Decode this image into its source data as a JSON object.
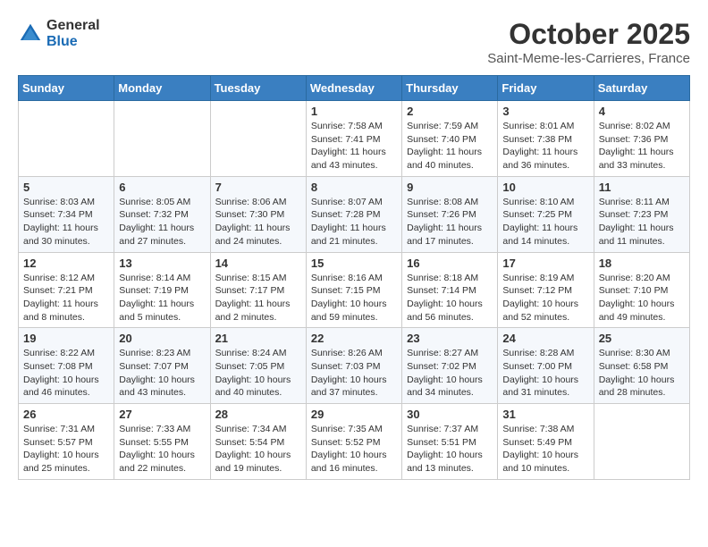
{
  "header": {
    "logo_general": "General",
    "logo_blue": "Blue",
    "month_title": "October 2025",
    "location": "Saint-Meme-les-Carrieres, France"
  },
  "weekdays": [
    "Sunday",
    "Monday",
    "Tuesday",
    "Wednesday",
    "Thursday",
    "Friday",
    "Saturday"
  ],
  "weeks": [
    [
      {
        "day": "",
        "info": ""
      },
      {
        "day": "",
        "info": ""
      },
      {
        "day": "",
        "info": ""
      },
      {
        "day": "1",
        "info": "Sunrise: 7:58 AM\nSunset: 7:41 PM\nDaylight: 11 hours and 43 minutes."
      },
      {
        "day": "2",
        "info": "Sunrise: 7:59 AM\nSunset: 7:40 PM\nDaylight: 11 hours and 40 minutes."
      },
      {
        "day": "3",
        "info": "Sunrise: 8:01 AM\nSunset: 7:38 PM\nDaylight: 11 hours and 36 minutes."
      },
      {
        "day": "4",
        "info": "Sunrise: 8:02 AM\nSunset: 7:36 PM\nDaylight: 11 hours and 33 minutes."
      }
    ],
    [
      {
        "day": "5",
        "info": "Sunrise: 8:03 AM\nSunset: 7:34 PM\nDaylight: 11 hours and 30 minutes."
      },
      {
        "day": "6",
        "info": "Sunrise: 8:05 AM\nSunset: 7:32 PM\nDaylight: 11 hours and 27 minutes."
      },
      {
        "day": "7",
        "info": "Sunrise: 8:06 AM\nSunset: 7:30 PM\nDaylight: 11 hours and 24 minutes."
      },
      {
        "day": "8",
        "info": "Sunrise: 8:07 AM\nSunset: 7:28 PM\nDaylight: 11 hours and 21 minutes."
      },
      {
        "day": "9",
        "info": "Sunrise: 8:08 AM\nSunset: 7:26 PM\nDaylight: 11 hours and 17 minutes."
      },
      {
        "day": "10",
        "info": "Sunrise: 8:10 AM\nSunset: 7:25 PM\nDaylight: 11 hours and 14 minutes."
      },
      {
        "day": "11",
        "info": "Sunrise: 8:11 AM\nSunset: 7:23 PM\nDaylight: 11 hours and 11 minutes."
      }
    ],
    [
      {
        "day": "12",
        "info": "Sunrise: 8:12 AM\nSunset: 7:21 PM\nDaylight: 11 hours and 8 minutes."
      },
      {
        "day": "13",
        "info": "Sunrise: 8:14 AM\nSunset: 7:19 PM\nDaylight: 11 hours and 5 minutes."
      },
      {
        "day": "14",
        "info": "Sunrise: 8:15 AM\nSunset: 7:17 PM\nDaylight: 11 hours and 2 minutes."
      },
      {
        "day": "15",
        "info": "Sunrise: 8:16 AM\nSunset: 7:15 PM\nDaylight: 10 hours and 59 minutes."
      },
      {
        "day": "16",
        "info": "Sunrise: 8:18 AM\nSunset: 7:14 PM\nDaylight: 10 hours and 56 minutes."
      },
      {
        "day": "17",
        "info": "Sunrise: 8:19 AM\nSunset: 7:12 PM\nDaylight: 10 hours and 52 minutes."
      },
      {
        "day": "18",
        "info": "Sunrise: 8:20 AM\nSunset: 7:10 PM\nDaylight: 10 hours and 49 minutes."
      }
    ],
    [
      {
        "day": "19",
        "info": "Sunrise: 8:22 AM\nSunset: 7:08 PM\nDaylight: 10 hours and 46 minutes."
      },
      {
        "day": "20",
        "info": "Sunrise: 8:23 AM\nSunset: 7:07 PM\nDaylight: 10 hours and 43 minutes."
      },
      {
        "day": "21",
        "info": "Sunrise: 8:24 AM\nSunset: 7:05 PM\nDaylight: 10 hours and 40 minutes."
      },
      {
        "day": "22",
        "info": "Sunrise: 8:26 AM\nSunset: 7:03 PM\nDaylight: 10 hours and 37 minutes."
      },
      {
        "day": "23",
        "info": "Sunrise: 8:27 AM\nSunset: 7:02 PM\nDaylight: 10 hours and 34 minutes."
      },
      {
        "day": "24",
        "info": "Sunrise: 8:28 AM\nSunset: 7:00 PM\nDaylight: 10 hours and 31 minutes."
      },
      {
        "day": "25",
        "info": "Sunrise: 8:30 AM\nSunset: 6:58 PM\nDaylight: 10 hours and 28 minutes."
      }
    ],
    [
      {
        "day": "26",
        "info": "Sunrise: 7:31 AM\nSunset: 5:57 PM\nDaylight: 10 hours and 25 minutes."
      },
      {
        "day": "27",
        "info": "Sunrise: 7:33 AM\nSunset: 5:55 PM\nDaylight: 10 hours and 22 minutes."
      },
      {
        "day": "28",
        "info": "Sunrise: 7:34 AM\nSunset: 5:54 PM\nDaylight: 10 hours and 19 minutes."
      },
      {
        "day": "29",
        "info": "Sunrise: 7:35 AM\nSunset: 5:52 PM\nDaylight: 10 hours and 16 minutes."
      },
      {
        "day": "30",
        "info": "Sunrise: 7:37 AM\nSunset: 5:51 PM\nDaylight: 10 hours and 13 minutes."
      },
      {
        "day": "31",
        "info": "Sunrise: 7:38 AM\nSunset: 5:49 PM\nDaylight: 10 hours and 10 minutes."
      },
      {
        "day": "",
        "info": ""
      }
    ]
  ]
}
